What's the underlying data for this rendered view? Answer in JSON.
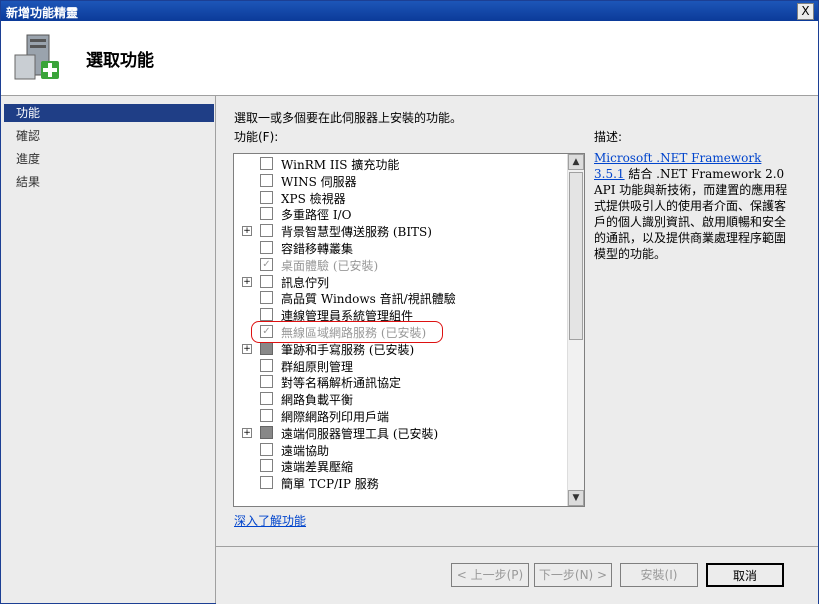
{
  "window": {
    "title": "新增功能精靈",
    "close_glyph": "X"
  },
  "header": {
    "heading": "選取功能",
    "icon": "server-add-icon"
  },
  "nav": {
    "items": [
      {
        "label": "功能",
        "active": true
      },
      {
        "label": "確認",
        "active": false
      },
      {
        "label": "進度",
        "active": false
      },
      {
        "label": "結果",
        "active": false
      }
    ]
  },
  "main": {
    "instruction": "選取一或多個要在此伺服器上安裝的功能。",
    "features_label": "功能(F):",
    "description_label": "描述:",
    "learn_more": "深入了解功能"
  },
  "features": [
    {
      "label": "WinRM IIS 擴充功能",
      "expand": false,
      "state": "unchecked",
      "disabled": false
    },
    {
      "label": "WINS 伺服器",
      "expand": false,
      "state": "unchecked",
      "disabled": false
    },
    {
      "label": "XPS 檢視器",
      "expand": false,
      "state": "unchecked",
      "disabled": false
    },
    {
      "label": "多重路徑 I/O",
      "expand": false,
      "state": "unchecked",
      "disabled": false
    },
    {
      "label": "背景智慧型傳送服務 (BITS)",
      "expand": true,
      "state": "unchecked",
      "disabled": false
    },
    {
      "label": "容錯移轉叢集",
      "expand": false,
      "state": "unchecked",
      "disabled": false
    },
    {
      "label": "桌面體驗 (已安裝)",
      "expand": false,
      "state": "checked",
      "disabled": true
    },
    {
      "label": "訊息佇列",
      "expand": true,
      "state": "unchecked",
      "disabled": false
    },
    {
      "label": "高品質 Windows 音訊/視訊體驗",
      "expand": false,
      "state": "unchecked",
      "disabled": false
    },
    {
      "label": "連線管理員系統管理組件",
      "expand": false,
      "state": "unchecked",
      "disabled": false
    },
    {
      "label": "無線區域網路服務 (已安裝)",
      "expand": false,
      "state": "checked",
      "disabled": true
    },
    {
      "label": "筆跡和手寫服務 (已安裝)",
      "expand": true,
      "state": "partial",
      "disabled": false
    },
    {
      "label": "群組原則管理",
      "expand": false,
      "state": "unchecked",
      "disabled": false
    },
    {
      "label": "對等名稱解析通訊協定",
      "expand": false,
      "state": "unchecked",
      "disabled": false
    },
    {
      "label": "網路負載平衡",
      "expand": false,
      "state": "unchecked",
      "disabled": false
    },
    {
      "label": "網際網路列印用戶端",
      "expand": false,
      "state": "unchecked",
      "disabled": false
    },
    {
      "label": "遠端伺服器管理工具 (已安裝)",
      "expand": true,
      "state": "partial",
      "disabled": false
    },
    {
      "label": "遠端協助",
      "expand": false,
      "state": "unchecked",
      "disabled": false
    },
    {
      "label": "遠端差異壓縮",
      "expand": false,
      "state": "unchecked",
      "disabled": false
    },
    {
      "label": "簡單 TCP/IP 服務",
      "expand": false,
      "state": "unchecked",
      "disabled": false
    }
  ],
  "description": {
    "link": "Microsoft .NET Framework 3.5.1",
    "text": " 結合 .NET Framework 2.0 API 功能與新技術，而建置的應用程式提供吸引人的使用者介面、保護客戶的個人識別資訊、啟用順暢和安全的通訊，以及提供商業處理程序範圍模型的功能。"
  },
  "buttons": {
    "back": "< 上一步(P)",
    "next": "下一步(N) >",
    "install": "安裝(I)",
    "cancel": "取消"
  }
}
